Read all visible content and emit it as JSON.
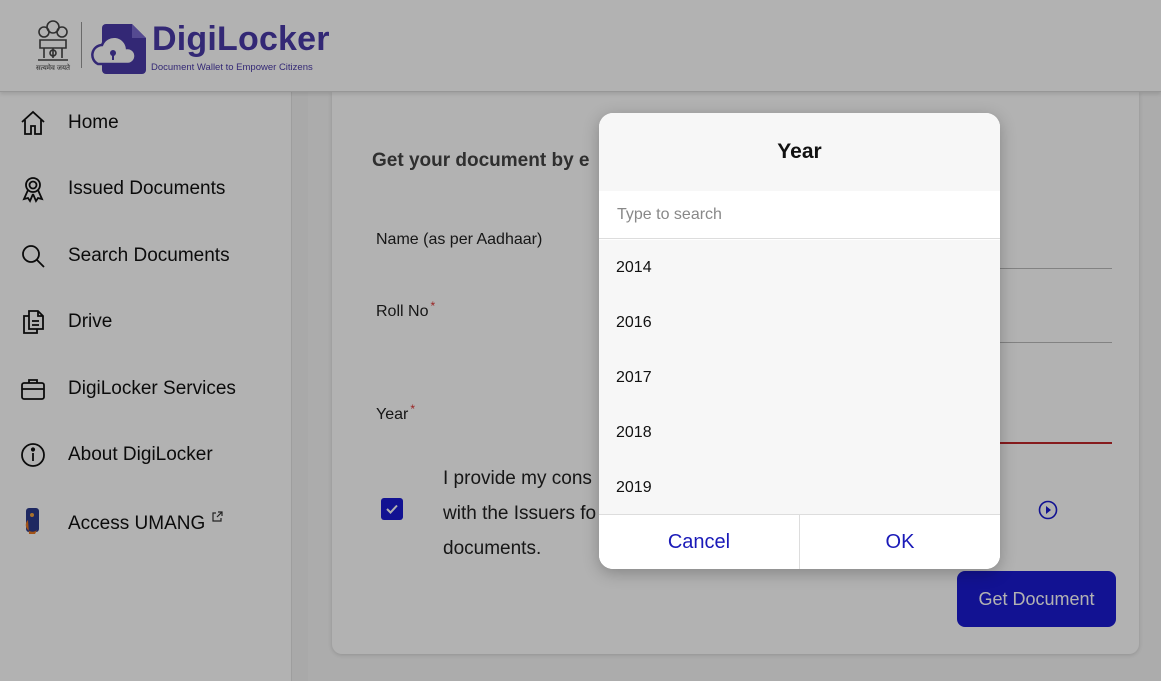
{
  "header": {
    "emblem_caption": "सत्यमेव जयते",
    "brand_name": "DigiLocker",
    "tagline": "Document Wallet to Empower Citizens"
  },
  "sidebar": {
    "items": [
      {
        "label": "Home",
        "icon": "home-icon"
      },
      {
        "label": "Issued Documents",
        "icon": "award-icon"
      },
      {
        "label": "Search Documents",
        "icon": "search-icon"
      },
      {
        "label": "Drive",
        "icon": "files-icon"
      },
      {
        "label": "DigiLocker Services",
        "icon": "briefcase-icon"
      },
      {
        "label": "About DigiLocker",
        "icon": "info-icon"
      },
      {
        "label": "Access UMANG",
        "icon": "umang-icon"
      }
    ]
  },
  "form": {
    "heading": "Get your document by e",
    "name_label": "Name (as per Aadhaar)",
    "roll_label": "Roll No",
    "year_label": "Year",
    "required_mark": "*",
    "consent_lines": [
      "I provide my cons",
      "with the Issuers fo",
      "documents."
    ],
    "consent_checked": true,
    "submit_label": "Get Document"
  },
  "colors": {
    "brand": "#4a3aa8",
    "primary_button": "#1a1ad1",
    "active_underline": "#c0282a",
    "dialog_action": "#1a1ab8"
  },
  "modal": {
    "title": "Year",
    "search_placeholder": "Type to search",
    "years": [
      "2014",
      "2016",
      "2017",
      "2018",
      "2019"
    ],
    "cancel_label": "Cancel",
    "ok_label": "OK"
  }
}
